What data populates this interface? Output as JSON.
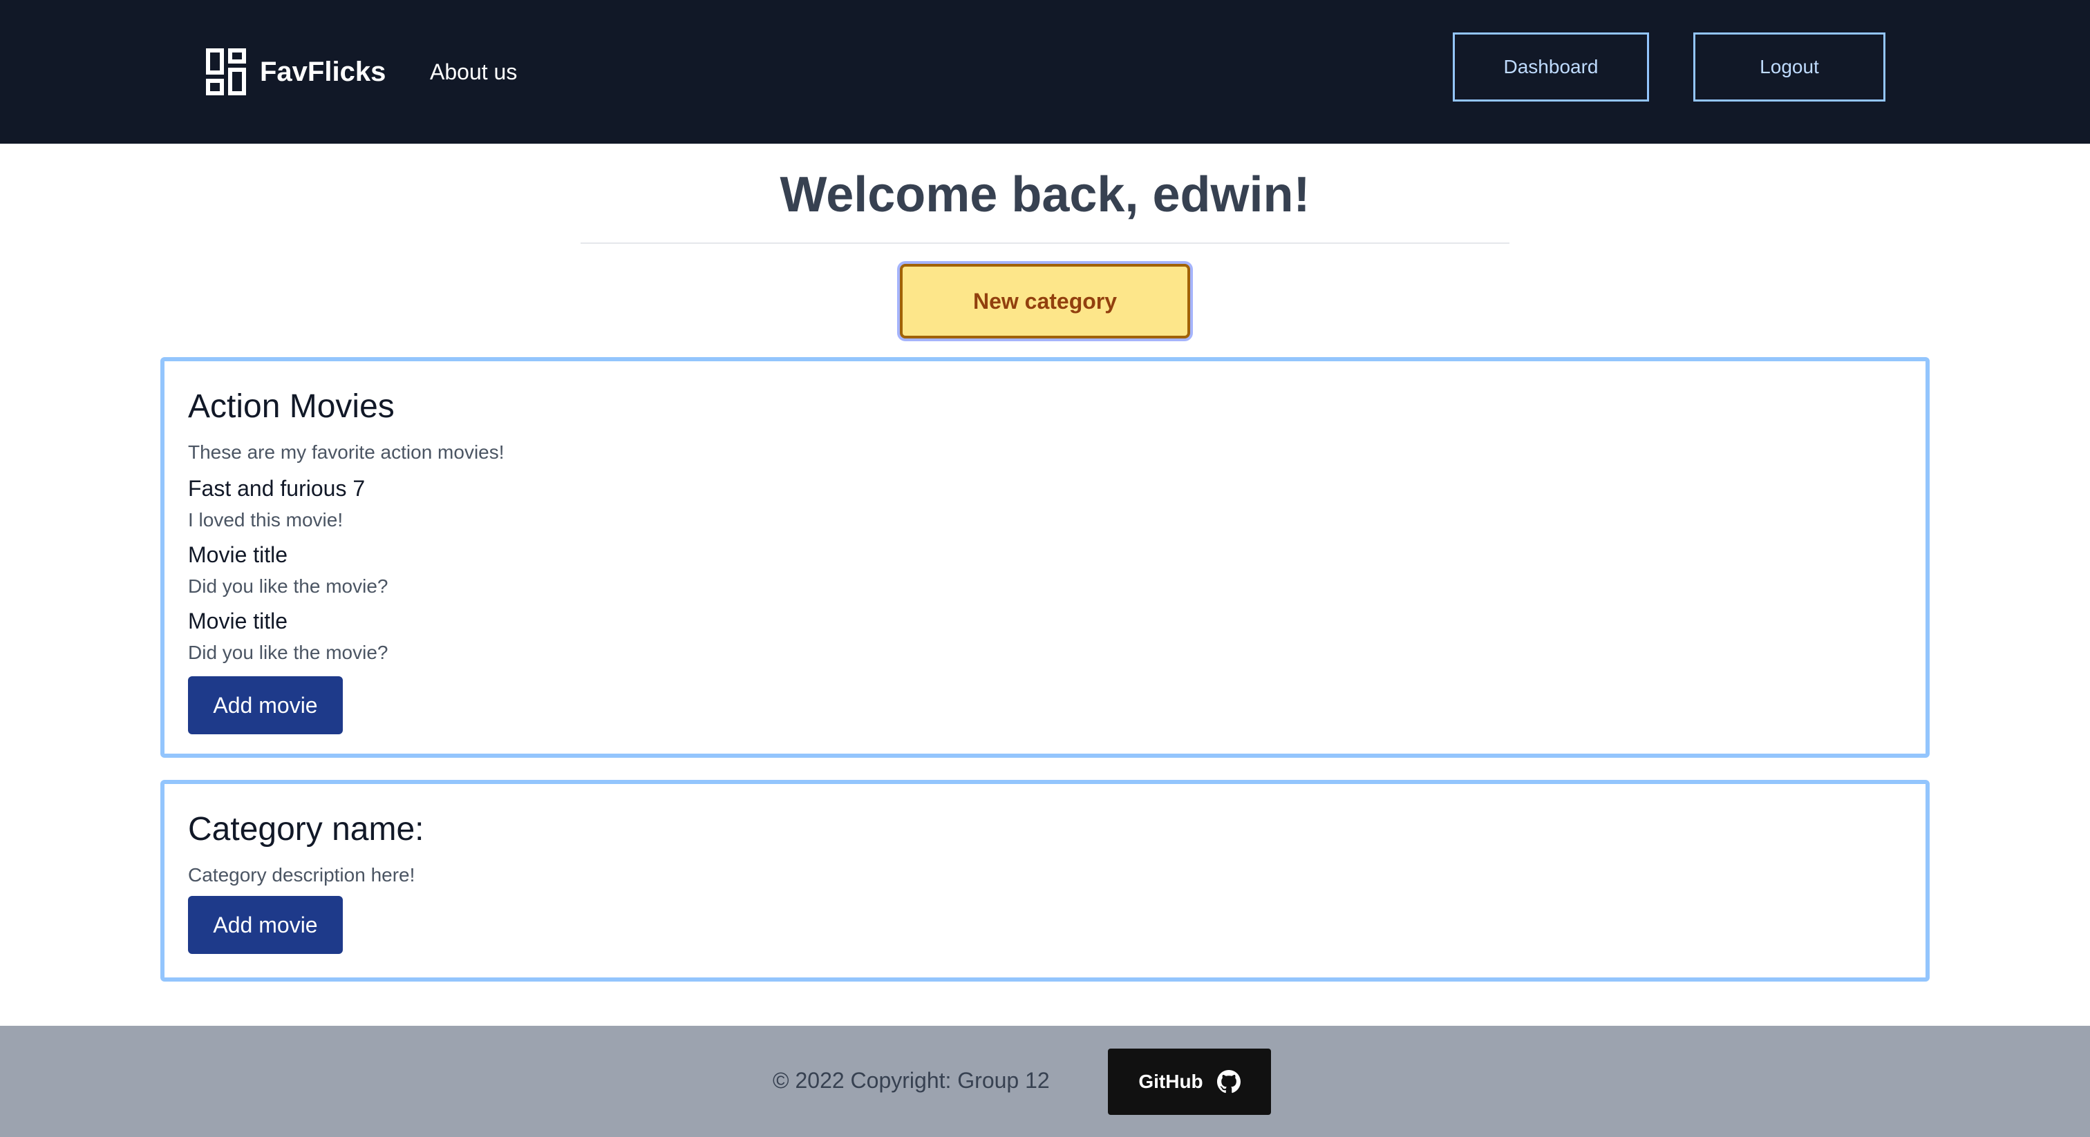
{
  "navbar": {
    "brand_icon": "dashboard-grid-icon",
    "brand_name": "FavFlicks",
    "about_label": "About us",
    "dashboard_label": "Dashboard",
    "logout_label": "Logout"
  },
  "main": {
    "welcome": "Welcome back, edwin!",
    "new_category_label": "New category"
  },
  "categories": [
    {
      "title": "Action Movies",
      "description": "These are my favorite action movies!",
      "movies": [
        {
          "title": "Fast and furious 7",
          "note": "I loved this movie!"
        },
        {
          "title": "Movie title",
          "note": "Did you like the movie?"
        },
        {
          "title": "Movie title",
          "note": "Did you like the movie?"
        }
      ],
      "add_label": "Add movie"
    },
    {
      "title": "Category name:",
      "description": "Category description here!",
      "movies": [],
      "add_label": "Add movie"
    }
  ],
  "footer": {
    "copyright": "© 2022 Copyright: Group 12",
    "github_label": "GitHub",
    "github_icon": "github-icon"
  },
  "colors": {
    "navbar_bg": "#111827",
    "accent_border": "#93c5fd",
    "new_category_bg": "#fde68a",
    "add_button_bg": "#1e3a8a",
    "footer_bg": "#9ca3af"
  }
}
